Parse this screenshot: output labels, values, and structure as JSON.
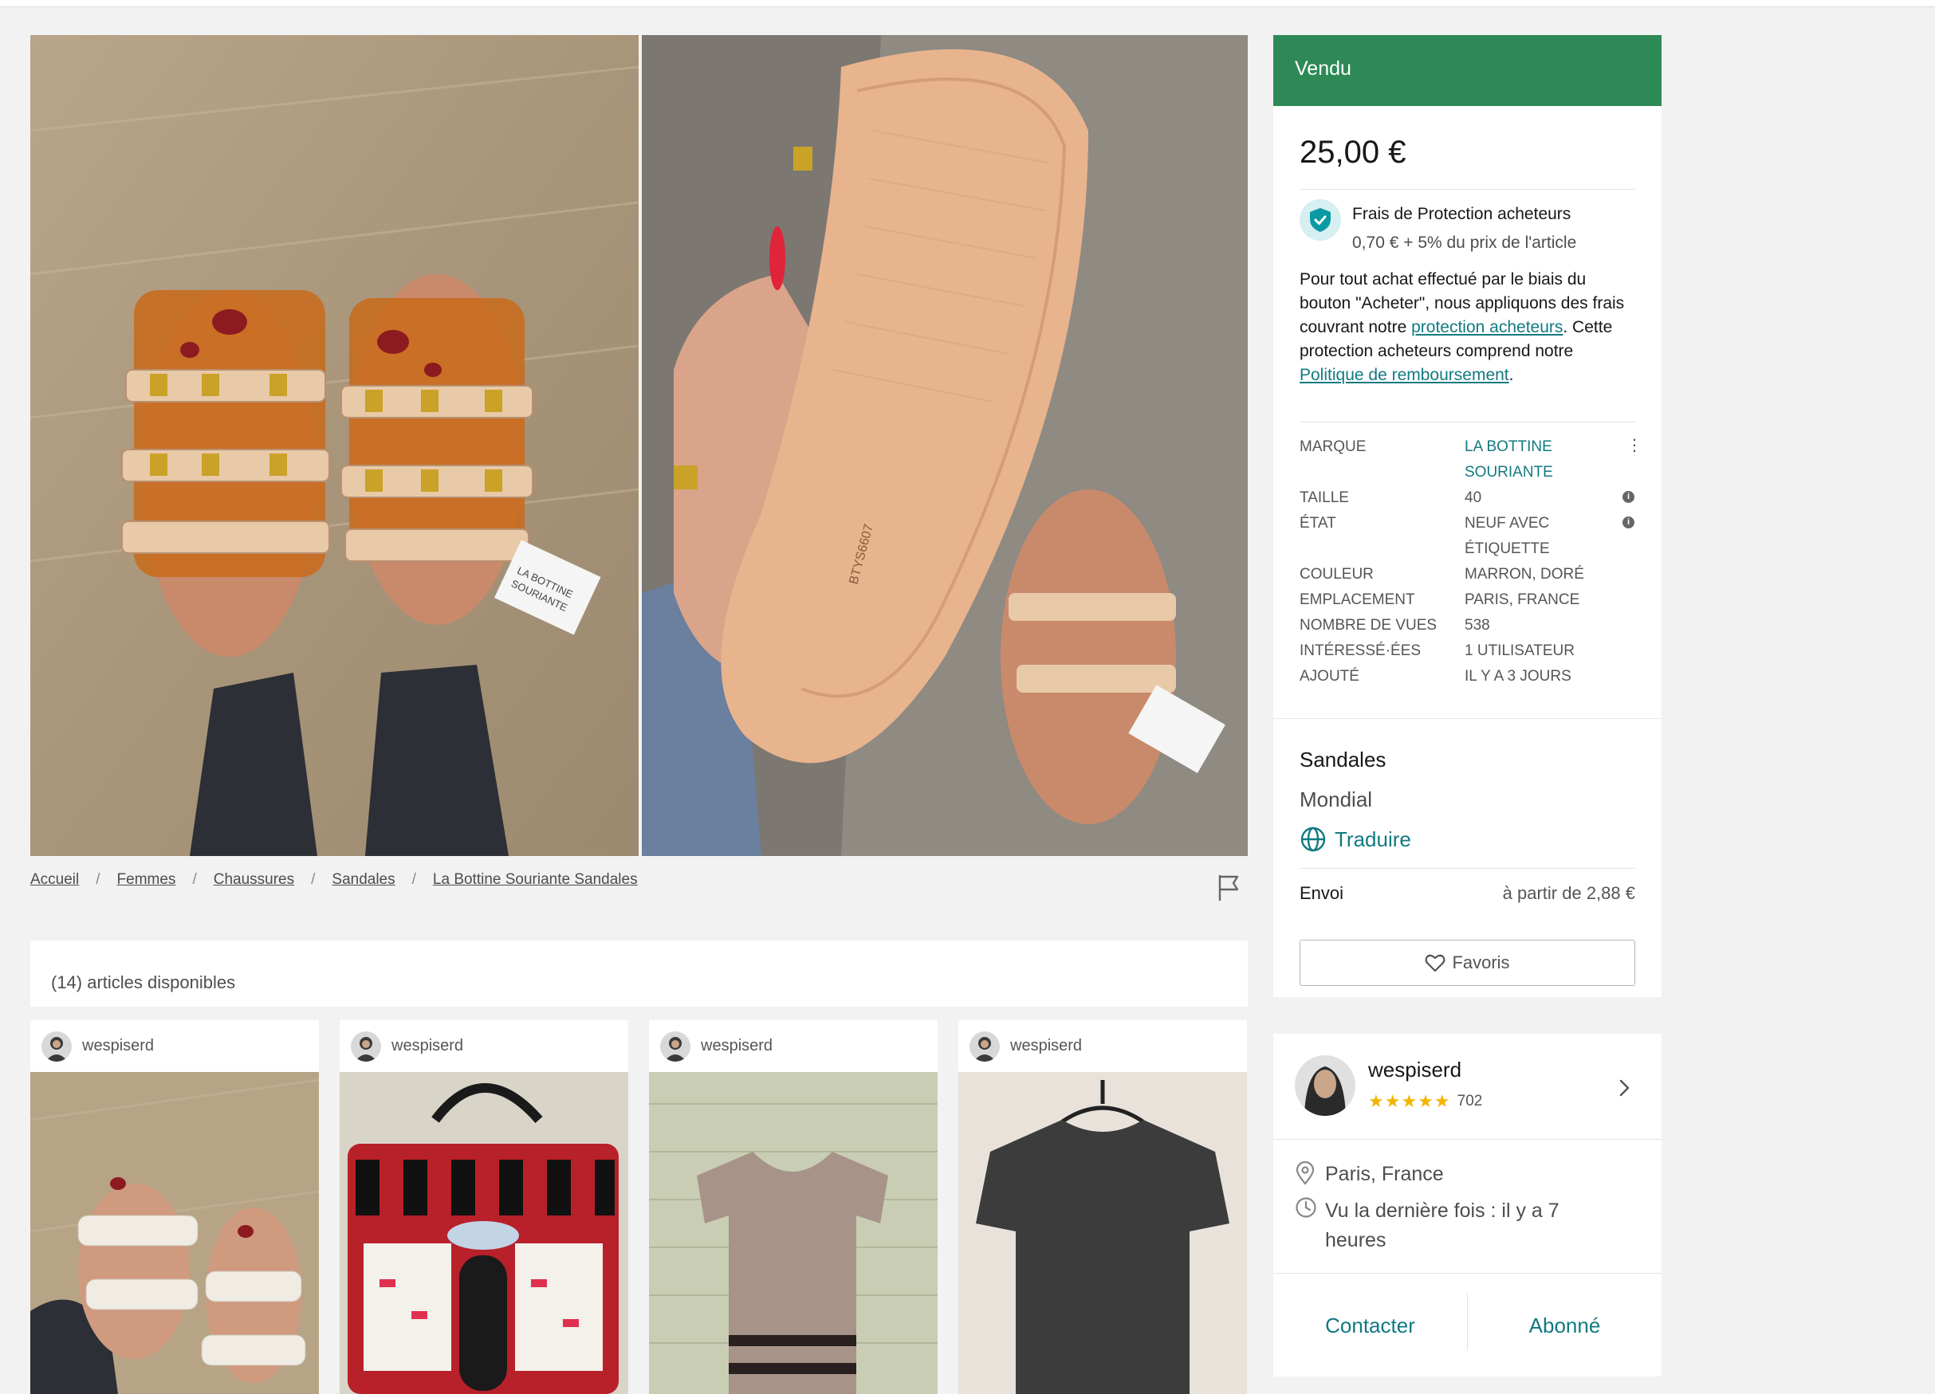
{
  "status_label": "Vendu",
  "price": "25,00 €",
  "protection": {
    "title": "Frais de Protection acheteurs",
    "fee": "0,70 € + 5% du prix de l'article",
    "text_1": "Pour tout achat effectué par le biais du bouton \"Acheter\", nous appliquons des frais couvrant notre ",
    "link_1": "protection acheteurs",
    "text_2": ". Cette protection acheteurs comprend notre ",
    "link_2": "Politique de remboursement",
    "text_3": "."
  },
  "details": [
    {
      "key": "MARQUE",
      "value": "LA BOTTINE SOURIANTE"
    },
    {
      "key": "TAILLE",
      "value": "40"
    },
    {
      "key": "ÉTAT",
      "value": "NEUF AVEC ÉTIQUETTE"
    },
    {
      "key": "COULEUR",
      "value": "MARRON, DORÉ"
    },
    {
      "key": "EMPLACEMENT",
      "value": "PARIS, FRANCE"
    },
    {
      "key": "NOMBRE DE VUES",
      "value": "538"
    },
    {
      "key": "INTÉRESSÉ·ÉES",
      "value": "1 UTILISATEUR"
    },
    {
      "key": "AJOUTÉ",
      "value": "IL Y A 3 JOURS"
    }
  ],
  "item_title": "Sandales",
  "item_description": "Mondial",
  "translate_label": "Traduire",
  "shipping": {
    "label": "Envoi",
    "value": "à partir de 2,88 €"
  },
  "favorite_label": "Favoris",
  "breadcrumb": [
    "Accueil",
    "Femmes",
    "Chaussures",
    "Sandales",
    "La Bottine Souriante Sandales"
  ],
  "breadcrumb_separator": "/",
  "available_label": "(14) articles disponibles",
  "closet_items": [
    {
      "username": "wespiserd"
    },
    {
      "username": "wespiserd"
    },
    {
      "username": "wespiserd"
    },
    {
      "username": "wespiserd"
    }
  ],
  "seller": {
    "username": "wespiserd",
    "stars": "★★★★★",
    "rating_value": 4.5,
    "review_count": "702",
    "location": "Paris, France",
    "last_seen": "Vu la dernière fois : il y a 7 heures",
    "contact_label": "Contacter",
    "follow_label": "Abonné"
  },
  "photo_tag_text": "LA BOTTINE SOURIANTE",
  "colors": {
    "status_green": "#2d8a56",
    "accent_teal": "#117a80",
    "star_gold": "#f4b400"
  },
  "icons": [
    "flag-icon",
    "shield-check-icon",
    "globe-icon",
    "heart-icon",
    "chevron-right-icon",
    "location-pin-icon",
    "clock-icon",
    "info-icon",
    "kebab-icon"
  ]
}
